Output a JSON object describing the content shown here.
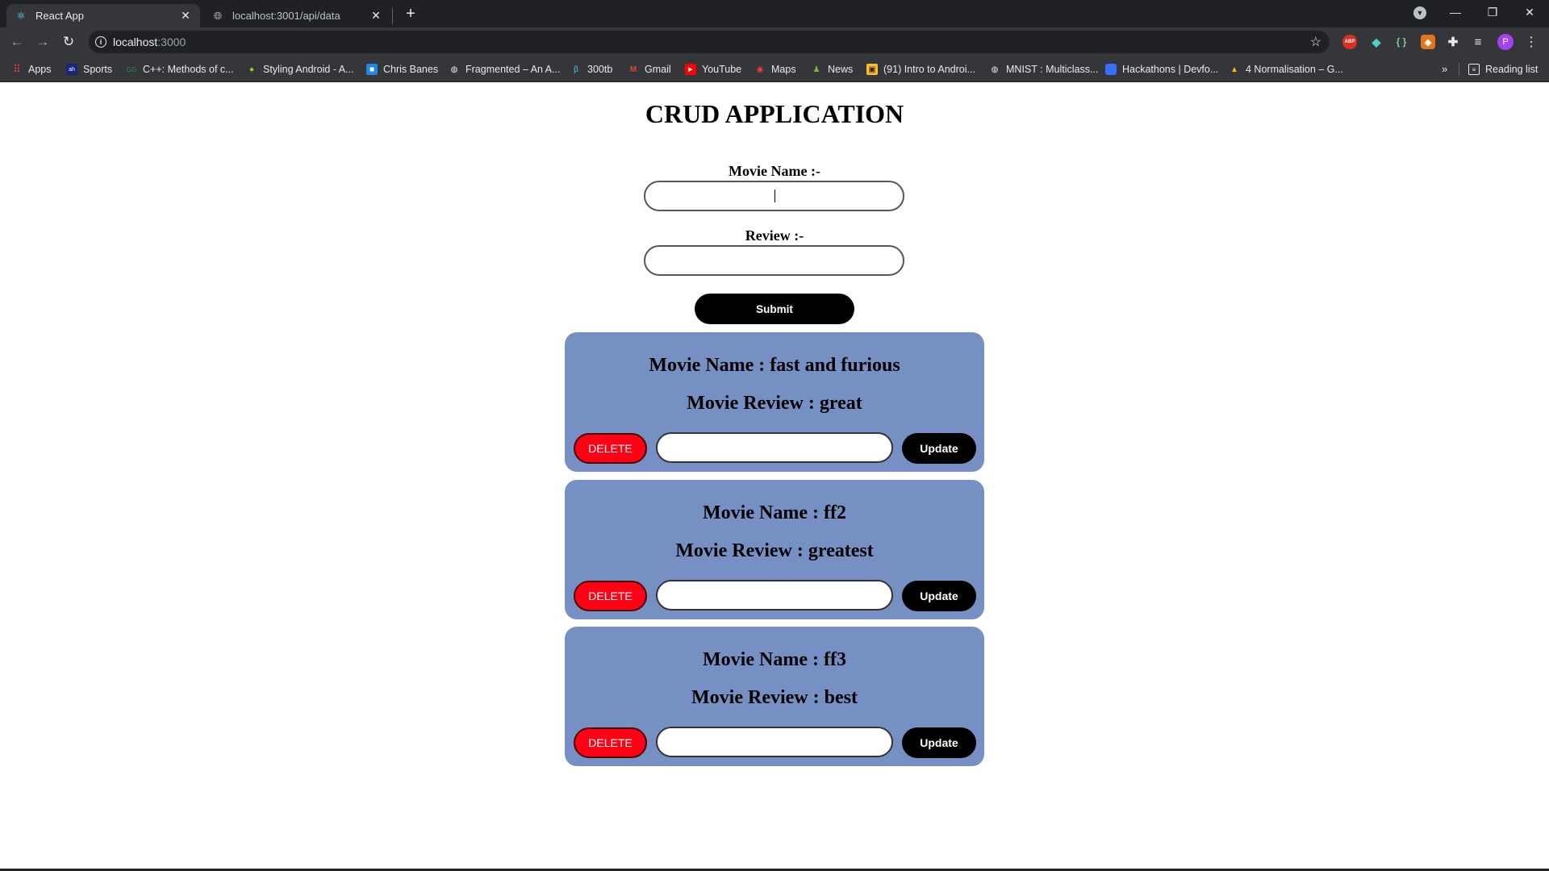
{
  "browser": {
    "tabs": [
      {
        "title": "React App",
        "icon": "react-icon"
      },
      {
        "title": "localhost:3001/api/data",
        "icon": "globe-icon"
      }
    ],
    "url_host": "localhost",
    "url_port": ":3000",
    "profile_initial": "P",
    "bookmarks": [
      "Apps",
      "Sports",
      "C++: Methods of c...",
      "Styling Android - A...",
      "Chris Banes",
      "Fragmented – An A...",
      "300tb",
      "Gmail",
      "YouTube",
      "Maps",
      "News",
      "(91) Intro to Androi...",
      "MNIST : Multiclass...",
      "Hackathons | Devfo...",
      "4 Normalisation – G..."
    ],
    "reading_list": "Reading list"
  },
  "app": {
    "title": "CRUD APPLICATION",
    "movie_name_label": "Movie Name :-",
    "review_label": "Review :-",
    "submit_label": "Submit",
    "movie_name_value": "",
    "review_value": ""
  },
  "movies": [
    {
      "name_line": "Movie Name : fast and furious",
      "review_line": "Movie Review : great",
      "delete_label": "DELETE",
      "update_label": "Update",
      "update_value": ""
    },
    {
      "name_line": "Movie Name : ff2",
      "review_line": "Movie Review : greatest",
      "delete_label": "DELETE",
      "update_label": "Update",
      "update_value": ""
    },
    {
      "name_line": "Movie Name : ff3",
      "review_line": "Movie Review : best",
      "delete_label": "DELETE",
      "update_label": "Update",
      "update_value": ""
    }
  ],
  "colors": {
    "card_bg": "#7690c4",
    "delete_bg": "#ff0014",
    "button_dark": "#000000"
  }
}
